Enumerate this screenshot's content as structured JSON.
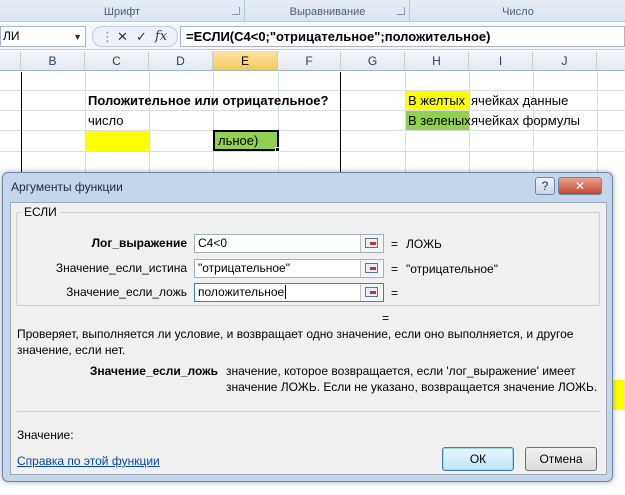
{
  "ribbon": {
    "font_group": "Шрифт",
    "align_group": "Выравнивание",
    "number_group": "Число"
  },
  "formula_bar": {
    "name_box": "ЛИ",
    "cancel_glyph": "✕",
    "enter_glyph": "✓",
    "fx_glyph": "fx",
    "formula": "=ЕСЛИ(C4<0;\"отрицательное\";положительное)"
  },
  "columns": [
    "B",
    "C",
    "D",
    "E",
    "F",
    "G",
    "H",
    "I",
    "J"
  ],
  "selected_column": "E",
  "cells": {
    "question": "Положительное или отрицательное?",
    "number_label": "число",
    "active_cell": "льное)",
    "legend_yellow_highlight": "В желтых",
    "legend_yellow_rest": "ячейках данные",
    "legend_green_highlight": "В зеленых",
    "legend_green_rest": "ячейках формулы"
  },
  "dialog": {
    "title": "Аргументы функции",
    "help_glyph": "?",
    "close_glyph": "✕",
    "function_name": "ЕСЛИ",
    "args": [
      {
        "label": "Лог_выражение",
        "value": "C4<0",
        "result": "ЛОЖЬ",
        "bold": true
      },
      {
        "label": "Значение_если_истина",
        "value": "\"отрицательное\"",
        "result": "\"отрицательное\"",
        "bold": false
      },
      {
        "label": "Значение_если_ложь",
        "value": "положительное",
        "result": "",
        "bold": false
      }
    ],
    "eq_sign": "=",
    "total_eq": "=",
    "description": "Проверяет, выполняется ли условие, и возвращает одно значение, если оно выполняется, и другое значение, если нет.",
    "param_name": "Значение_если_ложь",
    "param_description": "значение, которое возвращается, если 'лог_выражение' имеет значение ЛОЖЬ. Если не указано, возвращается значение ЛОЖЬ.",
    "value_label": "Значение:",
    "help_link": "Справка по этой функции",
    "ok_label": "ОК",
    "cancel_label": "Отмена"
  },
  "colors": {
    "yellow": "#ffff00",
    "green": "#92d050",
    "dialog_frame": "#c3d6ec"
  }
}
